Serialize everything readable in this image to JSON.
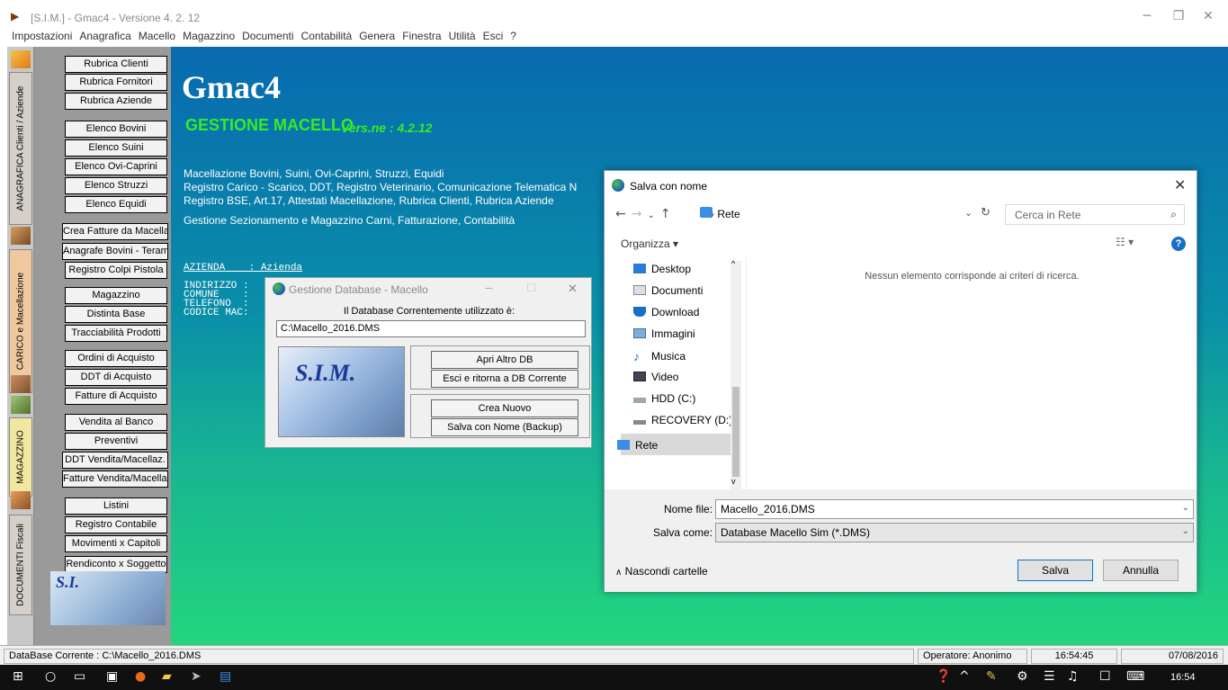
{
  "window": {
    "title": "[S.I.M.] - Gmac4 - Versione  4. 2. 12",
    "controls": [
      "minimize-icon",
      "restore-icon",
      "close-icon"
    ]
  },
  "menubar": [
    "Impostazioni",
    "Anagrafica",
    "Macello",
    "Magazzino",
    "Documenti",
    "Contabilità",
    "Genera",
    "Finestra",
    "Utilità",
    "Esci",
    "?"
  ],
  "vertical_tabs": [
    "ANAGRAFICA Clienti / Aziende",
    "CARICO e Macellazione",
    "MAGAZZINO",
    "DOCUMENTI Fiscali"
  ],
  "sidebar": {
    "buttons": [
      "Rubrica Clienti",
      "Rubrica Fornitori",
      "Rubrica Aziende",
      "Elenco Bovini",
      "Elenco Suini",
      "Elenco Ovi-Caprini",
      "Elenco Struzzi",
      "Elenco Equidi",
      "Crea Fatture da Macellaz.",
      "Anagrafe Bovini - Teramo",
      "Registro Colpi Pistola",
      "Magazzino",
      "Distinta Base",
      "Tracciabilità Prodotti",
      "Ordini di Acquisto",
      "DDT di Acquisto",
      "Fatture di Acquisto",
      "Vendita al Banco",
      "Preventivi",
      "DDT Vendita/Macellaz.",
      "Fatture Vendita/Macellaz.",
      "Listini",
      "Registro Contabile",
      "Movimenti x Capitoli",
      "Rendiconto x Soggetto"
    ],
    "image_text": "S.I."
  },
  "main": {
    "title": "Gmac4",
    "subtitle": "GESTIONE MACELLO",
    "version": "Vers.ne : 4.2.12",
    "desc": [
      "Macellazione Bovini, Suini, Ovi-Caprini, Struzzi, Equidi",
      "Registro Carico - Scarico, DDT, Registro Veterinario, Comunicazione Telematica N",
      "Registro BSE, Art.17, Attestati Macellazione, Rubrica Clienti, Rubrica Aziende",
      "Gestione Sezionamento e Magazzino Carni, Fatturazione, Contabilità"
    ],
    "azienda_line": "AZIENDA    : Azienda",
    "info_lines": [
      "INDIRIZZO :",
      "COMUNE    :",
      "TELEFONO  :",
      "CODICE MAC:"
    ]
  },
  "db_dialog": {
    "title": "Gestione Database - Macello",
    "label": "Il Database Correntemente utilizzato è:",
    "path": "C:\\Macello_2016.DMS",
    "image_text": "S.I.M.",
    "buttons": [
      "Apri Altro DB",
      "Esci e ritorna a DB Corrente",
      "Crea Nuovo",
      "Salva con Nome (Backup)"
    ]
  },
  "save_dialog": {
    "title": "Salva con nome",
    "path": "Rete",
    "search_placeholder": "Cerca in Rete",
    "organize": "Organizza ▾",
    "tree": [
      "Desktop",
      "Documenti",
      "Download",
      "Immagini",
      "Musica",
      "Video",
      "HDD (C:)",
      "RECOVERY (D:)",
      "Rete"
    ],
    "tree_icons": [
      "desktop-icon",
      "documents-icon",
      "download-icon",
      "images-icon",
      "music-icon",
      "video-icon",
      "drive-icon",
      "drive-icon",
      "network-icon"
    ],
    "empty_message": "Nessun elemento corrisponde ai criteri di ricerca.",
    "filename_label": "Nome file:",
    "filename": "Macello_2016.DMS",
    "type_label": "Salva come:",
    "type": "Database Macello Sim (*.DMS)",
    "hide_folders": "Nascondi cartelle",
    "save": "Salva",
    "cancel": "Annulla"
  },
  "status": {
    "database": "DataBase Corrente : C:\\Macello_2016.DMS",
    "operator": "Operatore: Anonimo",
    "time": "16:54:45",
    "date": "07/08/2016"
  },
  "taskbar": {
    "clock": "16:54"
  },
  "colors": {
    "main_top": "#086aaf",
    "main_bottom": "#22d67e",
    "subtitle_green": "#33ee22"
  }
}
